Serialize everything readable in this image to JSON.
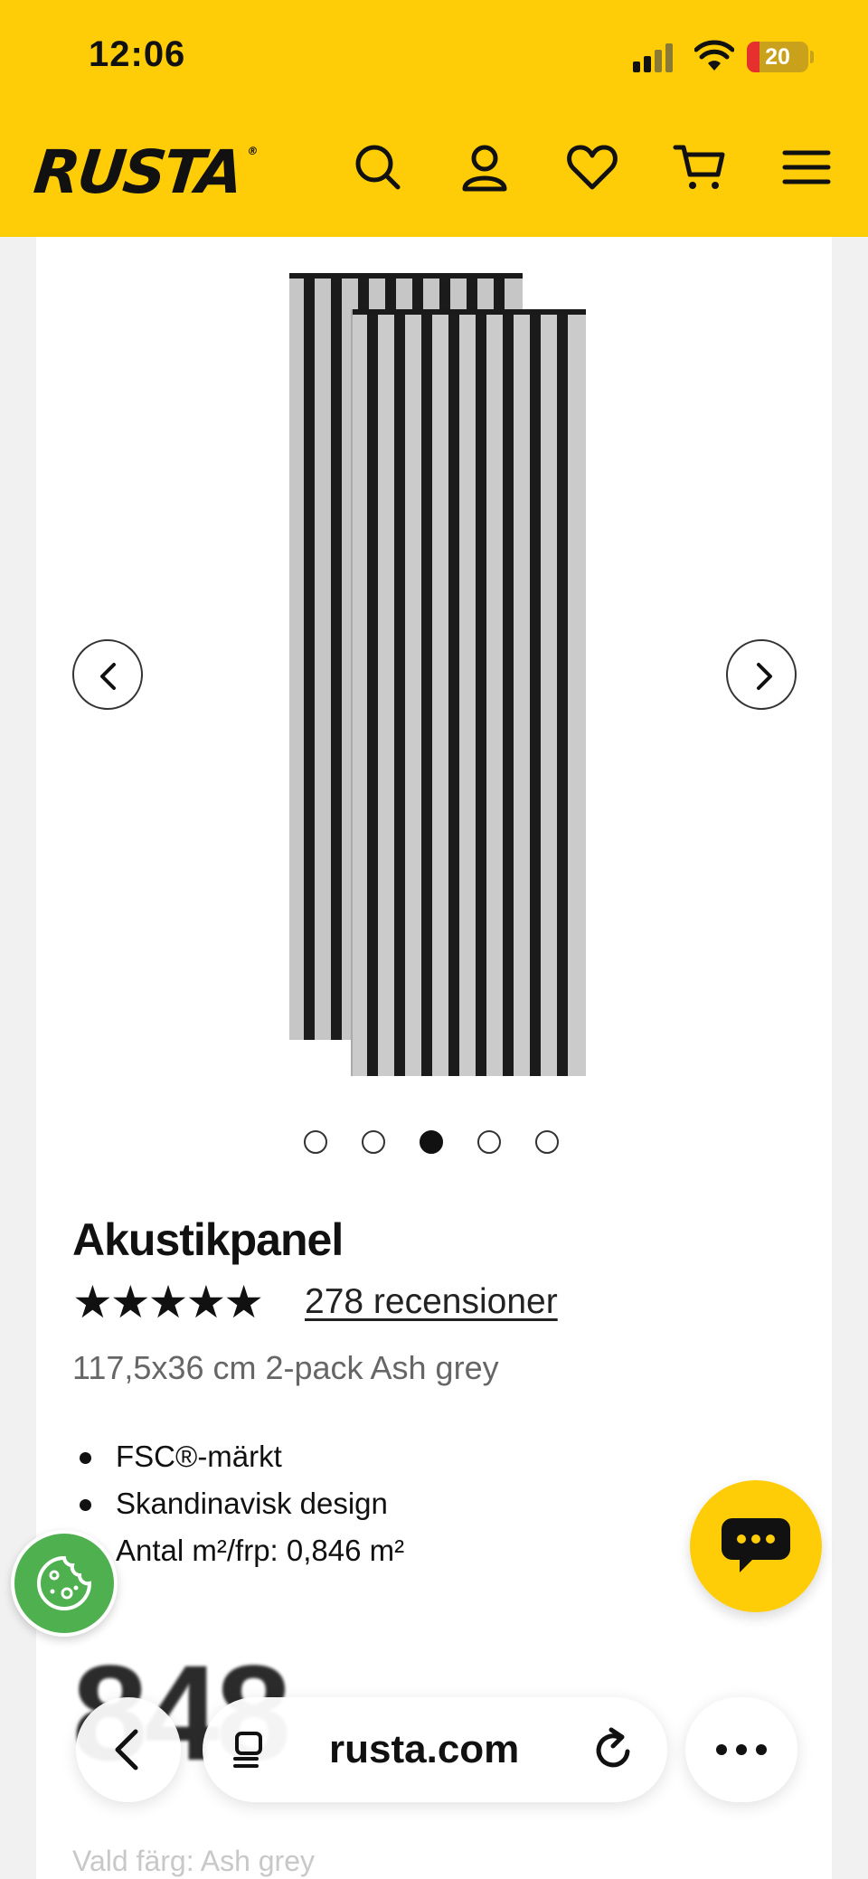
{
  "status_bar": {
    "time": "12:06",
    "battery": "20",
    "battery_level": 0.2
  },
  "header": {
    "logo": "RUSTA",
    "logo_mark": "®",
    "icons": [
      "search-icon",
      "account-icon",
      "heart-icon",
      "cart-icon",
      "menu-icon"
    ],
    "background": "#fecd07"
  },
  "gallery": {
    "dot_count": 5,
    "active_index": 2
  },
  "product": {
    "title": "Akustikpanel",
    "rating": 5,
    "stars": "★★★★★",
    "reviews": "278 recensioner",
    "subtitle": "117,5x36 cm 2-pack Ash grey",
    "features": [
      "FSC®-märkt",
      "Skandinavisk design",
      "Antal m²/frp: 0,846 m²"
    ],
    "price_partial": "848",
    "selected_color_label": "Vald färg:",
    "selected_color_value": "Ash grey"
  },
  "browser": {
    "url": "rusta.com"
  },
  "colors": {
    "accent": "#fecd07",
    "cookie": "#4fb050"
  }
}
